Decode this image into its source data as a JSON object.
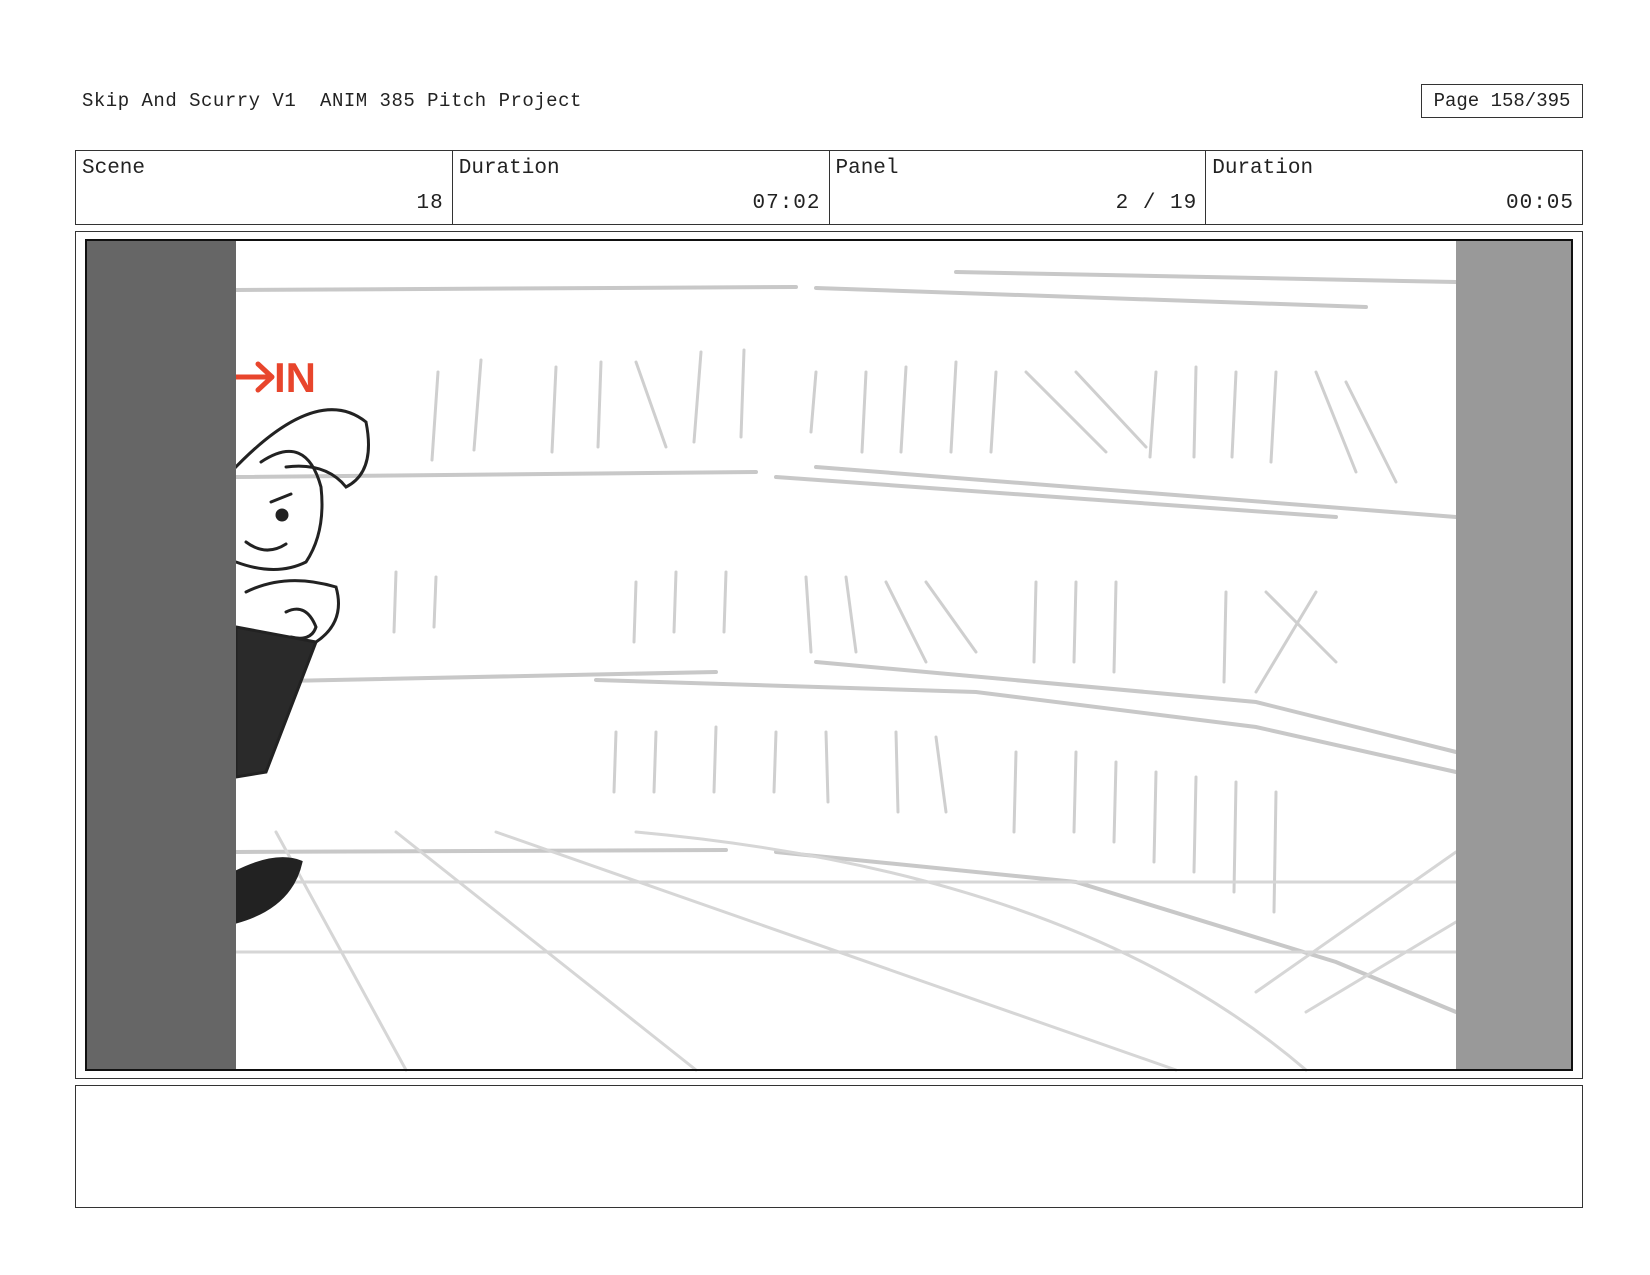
{
  "header": {
    "project_title": "Skip And Scurry V1  ANIM 385 Pitch Project",
    "page_indicator": "Page 158/395"
  },
  "info": {
    "scene_label": "Scene",
    "scene_value": "18",
    "duration_label": "Duration",
    "duration_value": "07:02",
    "panel_label": "Panel",
    "panel_value": "2 / 19",
    "panel_duration_label": "Duration",
    "panel_duration_value": "00:05"
  },
  "frame": {
    "annotation_text": "IN",
    "annotation_color": "#e8452c",
    "left_matte_color": "#666666",
    "right_matte_color": "#999999"
  },
  "notes": {
    "text": ""
  }
}
